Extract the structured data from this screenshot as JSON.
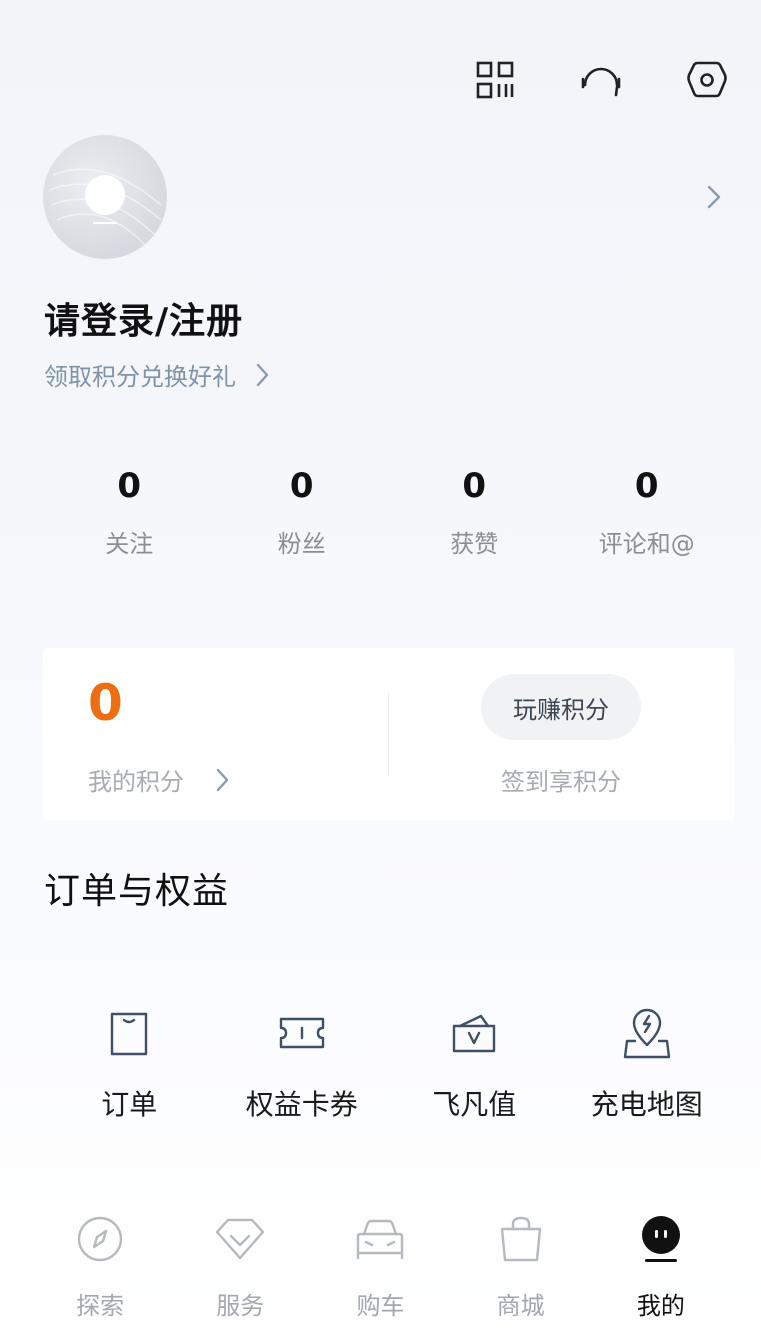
{
  "header": {
    "icons": [
      "qr-code-icon",
      "headset-icon",
      "settings-icon"
    ]
  },
  "profile": {
    "login_label": "请登录/注册",
    "points_link": "领取积分兑换好礼"
  },
  "stats": [
    {
      "value": "0",
      "label": "关注"
    },
    {
      "value": "0",
      "label": "粉丝"
    },
    {
      "value": "0",
      "label": "获赞"
    },
    {
      "value": "0",
      "label": "评论和@"
    }
  ],
  "points_card": {
    "my_points_value": "0",
    "my_points_label": "我的积分",
    "earn_button": "玩赚积分",
    "signin_label": "签到享积分"
  },
  "section": {
    "title": "订单与权益"
  },
  "rights": [
    {
      "label": "订单",
      "icon": "order-bag-icon"
    },
    {
      "label": "权益卡券",
      "icon": "coupon-icon"
    },
    {
      "label": "飞凡值",
      "icon": "wallet-icon"
    },
    {
      "label": "充电地图",
      "icon": "charging-map-icon"
    }
  ],
  "tabbar": {
    "items": [
      {
        "label": "探索",
        "icon": "compass-icon"
      },
      {
        "label": "服务",
        "icon": "service-diamond-icon"
      },
      {
        "label": "购车",
        "icon": "car-icon"
      },
      {
        "label": "商城",
        "icon": "shopping-bag-icon"
      },
      {
        "label": "我的",
        "icon": "profile-face-icon"
      }
    ],
    "active_index": 4
  },
  "colors": {
    "accent_orange": "#ec6d12",
    "muted_blue": "#7f93a8",
    "icon_stroke": "#3f4f66"
  }
}
